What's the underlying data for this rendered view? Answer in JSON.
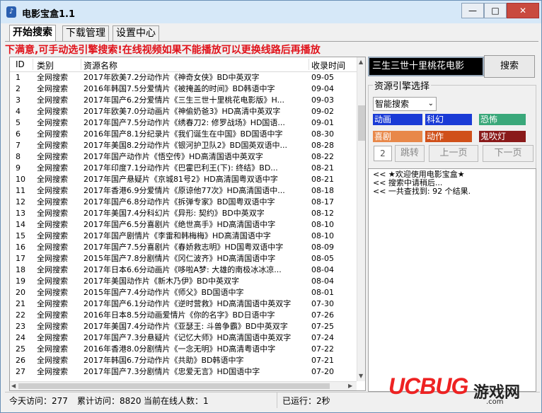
{
  "window": {
    "title": "电影宝盒1.1",
    "icon": "app-icon",
    "minimize": "—",
    "maximize": "□",
    "close": "✕"
  },
  "tabs": [
    {
      "label": "开始搜索",
      "active": true
    },
    {
      "label": "下载管理",
      "active": false
    },
    {
      "label": "设置中心",
      "active": false
    }
  ],
  "notice": "下满意,可手动选引擎搜索!在线视频如果不能播放可以更换线路后再播放",
  "table": {
    "headers": [
      "ID",
      "类别",
      "资源名称",
      "收录时间"
    ],
    "rows": [
      [
        "1",
        "全网搜索",
        "2017年欧美7.2分动作片《神奇女侠》BD中英双字",
        "09-05"
      ],
      [
        "2",
        "全网搜索",
        "2016年韩国7.5分爱情片《被掩盖的时间》BD韩语中字",
        "09-04"
      ],
      [
        "3",
        "全网搜索",
        "2017年国产6.2分爱情片《三生三世十里桃花电影版》H...",
        "09-03"
      ],
      [
        "4",
        "全网搜索",
        "2017年欧美7.0分动画片《神偷奶爸3》HD高清中英双字",
        "09-02"
      ],
      [
        "5",
        "全网搜索",
        "2017年国产7.5分动作片《绣春刀2: 修罗战场》HD国语...",
        "09-01"
      ],
      [
        "6",
        "全网搜索",
        "2016年国产8.1分纪录片《我们诞生在中国》BD国语中字",
        "08-30"
      ],
      [
        "7",
        "全网搜索",
        "2017年美国8.2分动作片《银河护卫队2》BD国英双语中...",
        "08-28"
      ],
      [
        "8",
        "全网搜索",
        "2017年国产动作片《悟空传》HD高清国语中英双字",
        "08-22"
      ],
      [
        "9",
        "全网搜索",
        "2017年印度7.1分动作片《巴霍巴利王(下): 终结》BD...",
        "08-21"
      ],
      [
        "10",
        "全网搜索",
        "2017年国产悬疑片《京城81号2》HD高清国粤双语中字",
        "08-21"
      ],
      [
        "11",
        "全网搜索",
        "2017年香港6.9分爱情片《原谅他77次》HD高清国语中...",
        "08-18"
      ],
      [
        "12",
        "全网搜索",
        "2017年国产6.8分动作片《拆弹专家》BD国粤双语中字",
        "08-17"
      ],
      [
        "13",
        "全网搜索",
        "2017年美国7.4分科幻片《异形: 契约》BD中英双字",
        "08-12"
      ],
      [
        "14",
        "全网搜索",
        "2017年国产6.5分喜剧片《绝世高手》HD高清国语中字",
        "08-10"
      ],
      [
        "15",
        "全网搜索",
        "2017年国产剧情片《李雷和韩梅梅》HD高清国语中字",
        "08-10"
      ],
      [
        "16",
        "全网搜索",
        "2017年国产7.5分喜剧片《春娇救志明》HD国粤双语中字",
        "08-09"
      ],
      [
        "17",
        "全网搜索",
        "2015年国产7.8分剧情片《冈仁波齐》HD高清国语中字",
        "08-05"
      ],
      [
        "18",
        "全网搜索",
        "2017年日本6.6分动画片《哆啦A梦: 大雄的南极冰冰凉...",
        "08-04"
      ],
      [
        "19",
        "全网搜索",
        "2017年美国动作片《新木乃伊》BD中英双字",
        "08-04"
      ],
      [
        "20",
        "全网搜索",
        "2015年国产7.4分动作片《师父》BD国语中字",
        "08-01"
      ],
      [
        "21",
        "全网搜索",
        "2017年国产6.1分动作片《逆时营救》HD高清国语中英双字",
        "07-30"
      ],
      [
        "22",
        "全网搜索",
        "2016年日本8.5分动画爱情片《你的名字》BD日语中字",
        "07-26"
      ],
      [
        "23",
        "全网搜索",
        "2017年美国7.4分动作片《亚瑟王: 斗兽争霸》BD中英双字",
        "07-25"
      ],
      [
        "24",
        "全网搜索",
        "2017年国产7.3分悬疑片《记忆大师》HD高清国语中英双字",
        "07-24"
      ],
      [
        "25",
        "全网搜索",
        "2016年香港8.0分剧情片《一念无明》HD高清粤语中字",
        "07-22"
      ],
      [
        "26",
        "全网搜索",
        "2017年韩国6.7分动作片《共助》BD韩语中字",
        "07-21"
      ],
      [
        "27",
        "全网搜索",
        "2017年国产7.3分剧情片《忠爱无言》HD国语中字",
        "07-20"
      ]
    ]
  },
  "search": {
    "value": "三生三世十里桃花电影",
    "button": "搜索"
  },
  "engine": {
    "group_title": "资源引擎选择",
    "selected": "智能搜索",
    "genres": [
      {
        "label": "动画",
        "color": "#1a3bd6"
      },
      {
        "label": "科幻",
        "color": "#1a3bd6"
      },
      {
        "label": "恐怖",
        "color": "#3aa87a"
      },
      {
        "label": "喜剧",
        "color": "#e8884a"
      },
      {
        "label": "动作",
        "color": "#d0501a"
      },
      {
        "label": "鬼吹灯",
        "color": "#8a1a1a"
      }
    ]
  },
  "pager": {
    "page": "2",
    "jump": "跳转",
    "prev": "上一页",
    "next": "下一页"
  },
  "log": [
    "<<  ★欢迎使用电影宝盒★",
    "<<  搜索中请稍后...",
    "<<  一共查找到:  92 个结果."
  ],
  "status": {
    "today": "今天访问：277",
    "total": "累计访问：8820",
    "online": "当前在线人数：1",
    "uptime": "已运行：2秒"
  },
  "watermark": {
    "brand": "UCBUG",
    "cn": "游戏网",
    "url": ".com"
  }
}
